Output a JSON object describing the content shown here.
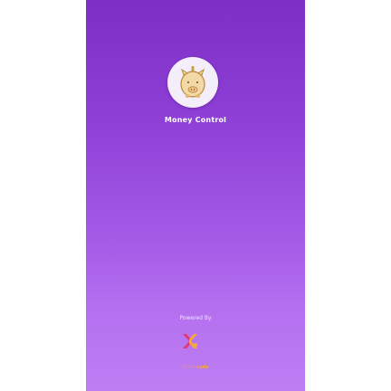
{
  "app": {
    "title": "Money Control",
    "logo_icon": "piggy-bank-icon"
  },
  "footer": {
    "powered_by": "Powered By",
    "brand_icon": "brand-logo-icon",
    "brand_name_part1": "Plural",
    "brand_name_part2": "code"
  },
  "colors": {
    "gradient_top": "#7d2fc4",
    "gradient_bottom": "#bd7ef2",
    "logo_bg": "#f4eefb",
    "brand_orange": "#f6a93b",
    "brand_pink": "#d98aa6"
  }
}
